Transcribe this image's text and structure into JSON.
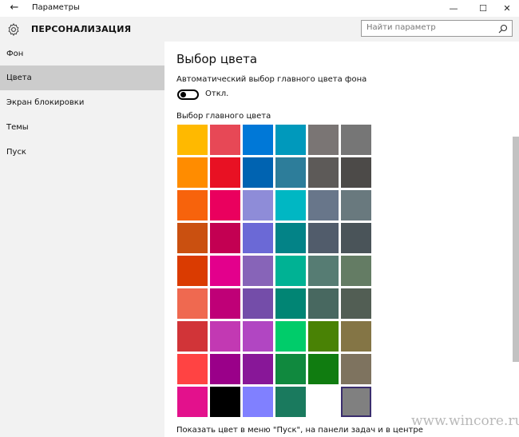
{
  "window": {
    "title": "Параметры",
    "back_glyph": "←",
    "minimize_glyph": "—",
    "maximize_glyph": "☐",
    "close_glyph": "✕"
  },
  "header": {
    "section_title": "ПЕРСОНАЛИЗАЦИЯ",
    "search_placeholder": "Найти параметр",
    "icons": [
      "gear-icon",
      "search-icon"
    ]
  },
  "sidebar": {
    "items": [
      {
        "label": "Фон",
        "active": false
      },
      {
        "label": "Цвета",
        "active": true
      },
      {
        "label": "Экран блокировки",
        "active": false
      },
      {
        "label": "Темы",
        "active": false
      },
      {
        "label": "Пуск",
        "active": false
      }
    ]
  },
  "content": {
    "heading": "Выбор цвета",
    "auto_label": "Автоматический выбор главного цвета фона",
    "toggle_text": "Откл.",
    "toggle_on": false,
    "palette_label": "Выбор главного цвета",
    "bottom_label": "Показать цвет в меню \"Пуск\", на панели задач и в центре"
  },
  "palette": {
    "columns": 6,
    "selected_index": 53,
    "colors": [
      "#FFB900",
      "#E74856",
      "#0078D7",
      "#0099BC",
      "#7A7574",
      "#767676",
      "#FF8C00",
      "#E81123",
      "#0063B1",
      "#2D7D9A",
      "#5D5A58",
      "#4C4A48",
      "#F7630C",
      "#EA005E",
      "#8E8CD8",
      "#00B7C3",
      "#68768A",
      "#69797E",
      "#CA5010",
      "#C30052",
      "#6B69D6",
      "#038387",
      "#515C6B",
      "#4A5459",
      "#DA3B01",
      "#E3008C",
      "#8764B8",
      "#00B294",
      "#567C73",
      "#647C64",
      "#EF6950",
      "#BF0077",
      "#744DA9",
      "#018574",
      "#486860",
      "#525E54",
      "#D13438",
      "#C239B3",
      "#B146C2",
      "#00CC6A",
      "#498205",
      "#847545",
      "#FF4343",
      "#9A0089",
      "#881798",
      "#10893E",
      "#107C10",
      "#7E735F",
      "#E3118C",
      "#000000",
      "#8080FF",
      "#1A7A5E",
      "#FFFFFF",
      "#808080"
    ]
  },
  "watermark": "www.wincore.ru"
}
